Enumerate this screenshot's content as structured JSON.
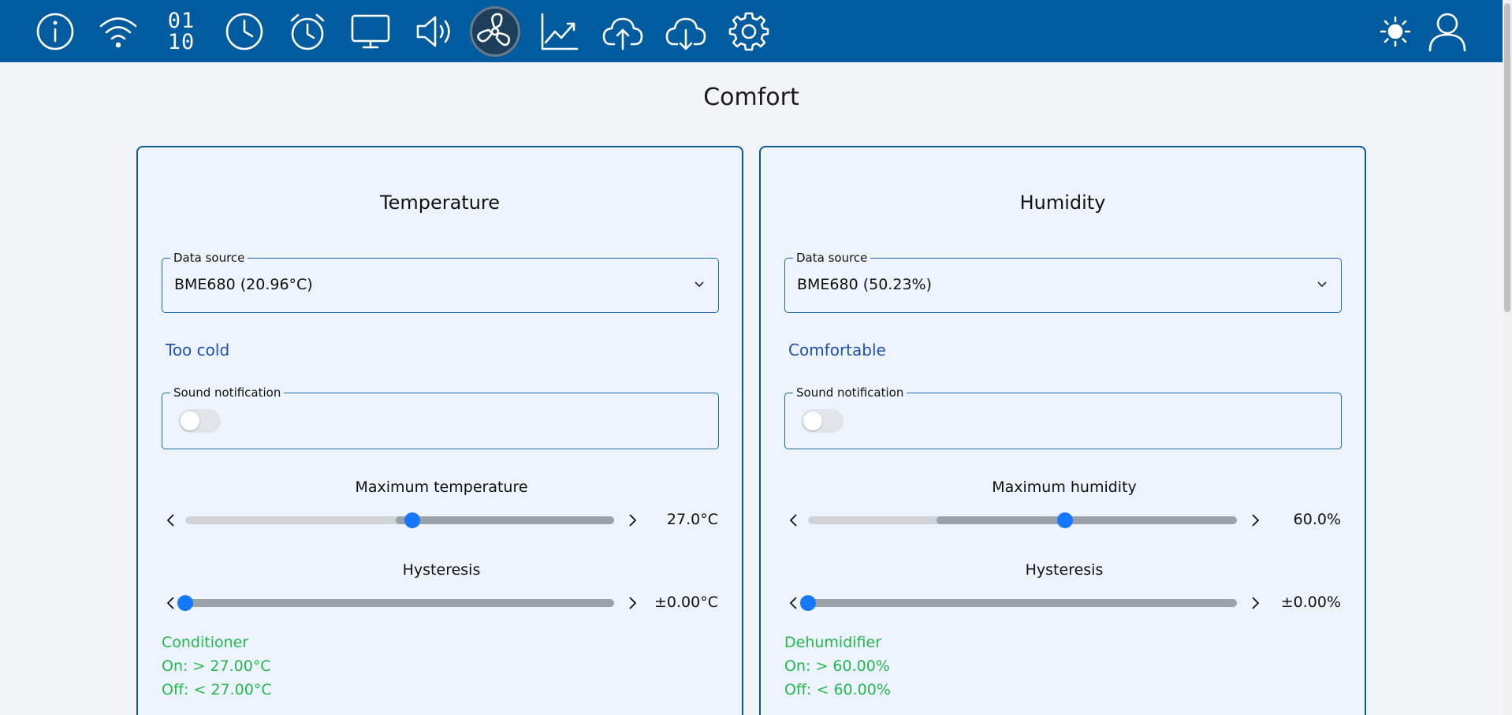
{
  "nav": {
    "icons": [
      "info-icon",
      "wifi-icon",
      "binary-icon",
      "clock-icon",
      "alarm-clock-icon",
      "display-icon",
      "speaker-icon",
      "fan-icon",
      "chart-icon",
      "cloud-upload-icon",
      "cloud-download-icon",
      "gear-icon",
      "sun-icon",
      "user-icon"
    ],
    "binary_top": "01",
    "binary_bottom": "10",
    "active": "fan-icon"
  },
  "page": {
    "title": "Comfort"
  },
  "temperature": {
    "title": "Temperature",
    "data_source_label": "Data source",
    "data_source_value": "BME680 (20.96°C)",
    "status": "Too cold",
    "sound_label": "Sound notification",
    "sound_enabled": false,
    "max_label": "Maximum temperature",
    "max_value": "27.0°C",
    "max_fraction": 0.53,
    "max_range_start_fraction": 0.49,
    "hyst_label": "Hysteresis",
    "hyst_value": "±0.00°C",
    "hyst_fraction": 0.0,
    "device_name": "Conditioner",
    "device_on": "On: > 27.00°C",
    "device_off": "Off: < 27.00°C"
  },
  "humidity": {
    "title": "Humidity",
    "data_source_label": "Data source",
    "data_source_value": "BME680 (50.23%)",
    "status": "Comfortable",
    "sound_label": "Sound notification",
    "sound_enabled": false,
    "max_label": "Maximum humidity",
    "max_value": "60.0%",
    "max_fraction": 0.6,
    "max_range_start_fraction": 0.3,
    "hyst_label": "Hysteresis",
    "hyst_value": "±0.00%",
    "hyst_fraction": 0.0,
    "device_name": "Dehumidifier",
    "device_on": "On: > 60.00%",
    "device_off": "Off: < 60.00%"
  },
  "colors": {
    "topbar": "#005c9e",
    "accent": "#1677ff",
    "status_text": "#1e4fb5",
    "device_text": "#21b84c"
  }
}
